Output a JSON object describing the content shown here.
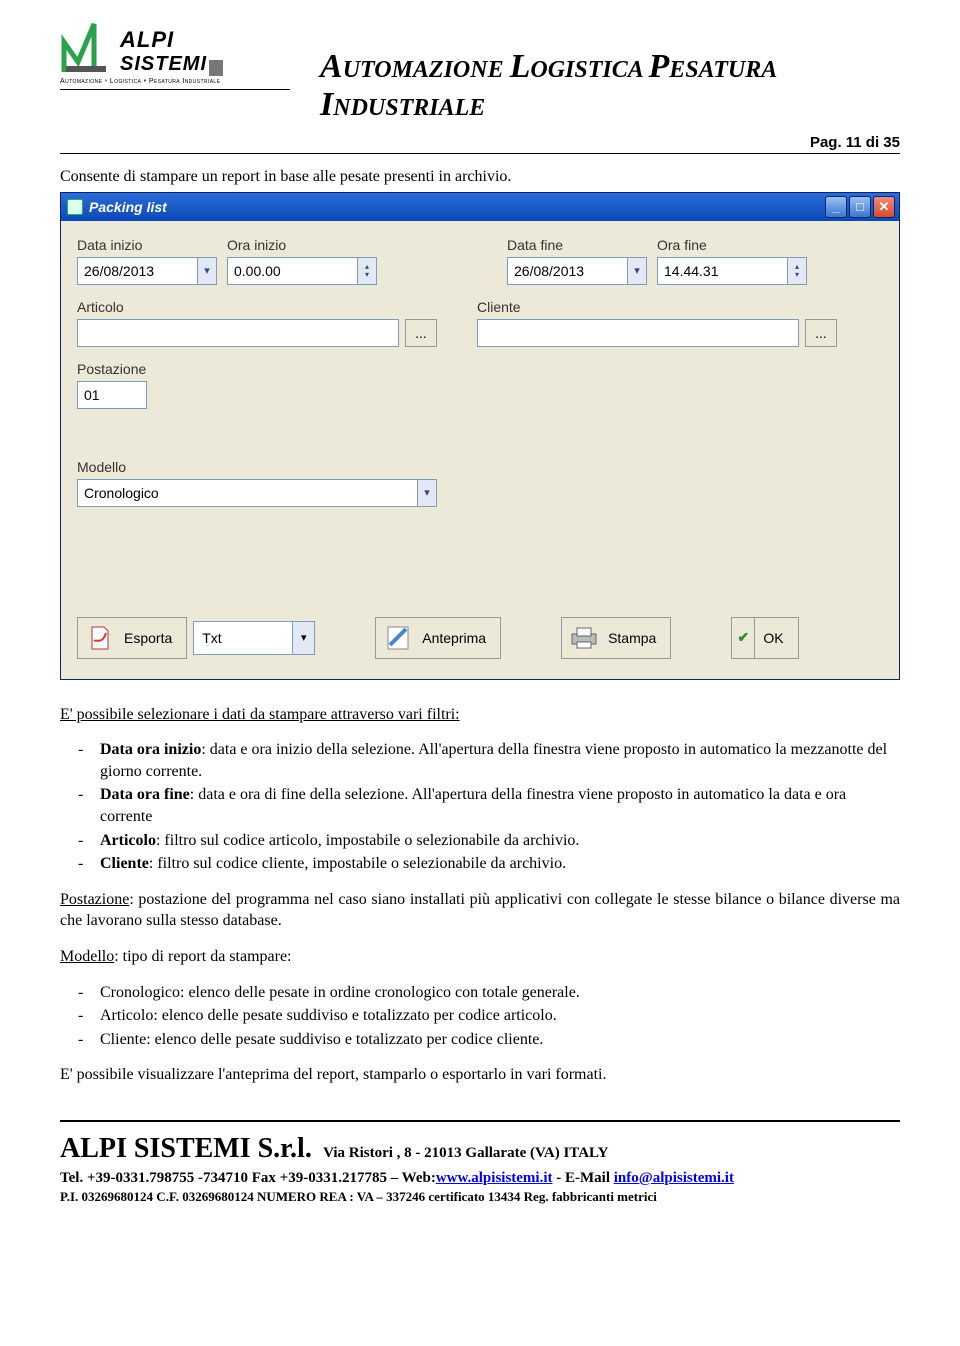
{
  "header": {
    "logo_alpi": "ALPI",
    "logo_sistemi": "SISTEMI",
    "logo_sub": "Automazione • Logistica • Pesatura Industriale",
    "tagline_words": [
      "A",
      "UTOMAZIONE ",
      "L",
      "OGISTICA ",
      "P",
      "ESATURA ",
      "I",
      "NDUSTRIALE"
    ],
    "page_num": "Pag. 11 di 35"
  },
  "intro_line": "Consente di stampare un report in base alle pesate presenti in archivio.",
  "window": {
    "title": "Packing list",
    "fields": {
      "data_inizio": {
        "label": "Data inizio",
        "value": "26/08/2013"
      },
      "ora_inizio": {
        "label": "Ora  inizio",
        "value": "0.00.00"
      },
      "data_fine": {
        "label": "Data fine",
        "value": "26/08/2013"
      },
      "ora_fine": {
        "label": "Ora  fine",
        "value": "14.44.31"
      },
      "articolo": {
        "label": "Articolo",
        "value": ""
      },
      "cliente": {
        "label": "Cliente",
        "value": ""
      },
      "postazione": {
        "label": "Postazione",
        "value": "01"
      },
      "modello": {
        "label": "Modello",
        "value": "Cronologico"
      }
    },
    "actions": {
      "esporta": "Esporta",
      "format": "Txt",
      "anteprima": "Anteprima",
      "stampa": "Stampa",
      "ok": "OK"
    }
  },
  "para1_lead": "E' possibile selezionare i dati da stampare attraverso vari filtri:",
  "bullets1": [
    [
      "Data ora inizio",
      ": data e ora inizio della selezione. All'apertura della finestra viene proposto in automatico la mezzanotte del giorno corrente."
    ],
    [
      "Data ora fine",
      ": data e ora di fine della selezione. All'apertura della finestra viene proposto in automatico la data e ora corrente"
    ],
    [
      "Articolo",
      ": filtro sul codice articolo, impostabile o selezionabile da archivio."
    ],
    [
      "Cliente",
      ": filtro sul codice cliente, impostabile o selezionabile da archivio."
    ]
  ],
  "para_postazione_head": "Postazione",
  "para_postazione_body": ": postazione del programma nel caso siano installati più applicativi con collegate le stesse bilance o bilance diverse ma che lavorano sulla stesso database.",
  "para_modello_head": "Modello",
  "para_modello_body": ": tipo di report da stampare:",
  "bullets2": [
    "Cronologico: elenco delle pesate in ordine cronologico con totale generale.",
    "Articolo: elenco delle pesate suddiviso e totalizzato per codice articolo.",
    "Cliente: elenco delle pesate suddiviso e totalizzato per codice cliente."
  ],
  "para_last": "E' possibile visualizzare l'anteprima del report, stamparlo o esportarlo in vari formati.",
  "footer": {
    "company": "ALPI SISTEMI S.r.l.",
    "addr": "Via  Ristori , 8 - 21013    Gallarate  (VA)    ITALY",
    "line2_a": "Tel.  +39-0331.798755  -734710     Fax  +39-0331.217785  –  Web:",
    "web": "www.alpisistemi.it",
    "line2_b": "  -  E-Mail   ",
    "email": "info@alpisistemi.it",
    "line3": "P.I.    03269680124            C.F. 03269680124            NUMERO REA : VA – 337246                    certificato 13434  Reg. fabbricanti  metrici"
  }
}
